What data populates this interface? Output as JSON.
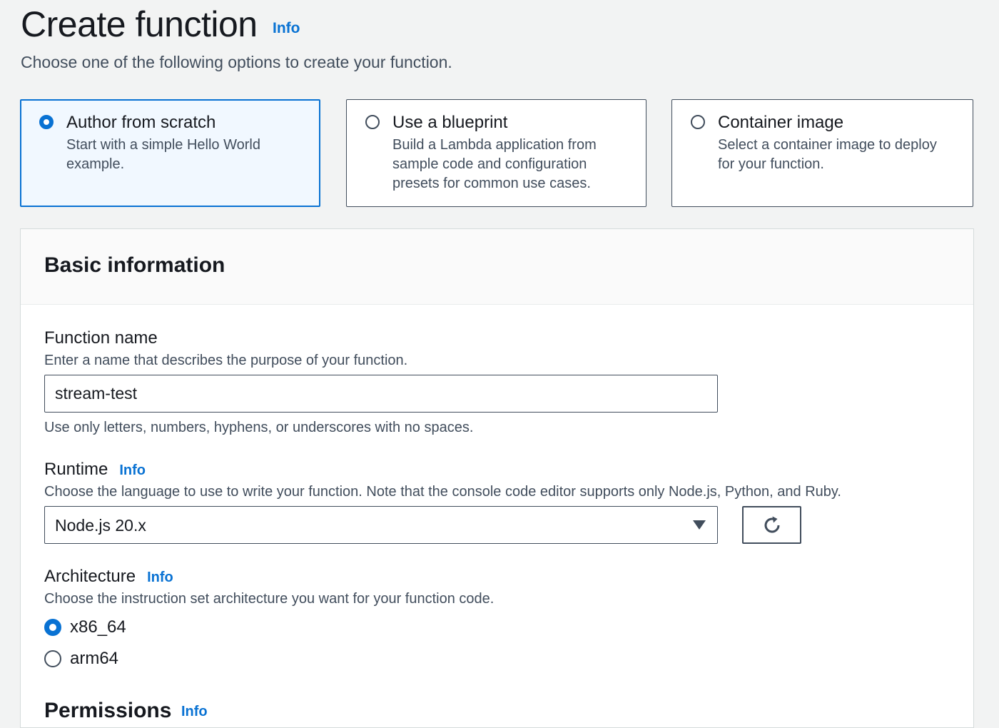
{
  "header": {
    "title": "Create function",
    "info_label": "Info",
    "description": "Choose one of the following options to create your function."
  },
  "creation_options": [
    {
      "title": "Author from scratch",
      "description": "Start with a simple Hello World example.",
      "selected": true
    },
    {
      "title": "Use a blueprint",
      "description": "Build a Lambda application from sample code and configuration presets for common use cases.",
      "selected": false
    },
    {
      "title": "Container image",
      "description": "Select a container image to deploy for your function.",
      "selected": false
    }
  ],
  "basic_information": {
    "title": "Basic information",
    "function_name": {
      "label": "Function name",
      "description": "Enter a name that describes the purpose of your function.",
      "value": "stream-test",
      "constraint": "Use only letters, numbers, hyphens, or underscores with no spaces."
    },
    "runtime": {
      "label": "Runtime",
      "info_label": "Info",
      "description": "Choose the language to use to write your function. Note that the console code editor supports only Node.js, Python, and Ruby.",
      "selected_value": "Node.js 20.x",
      "refresh_icon": "refresh-icon"
    },
    "architecture": {
      "label": "Architecture",
      "info_label": "Info",
      "description": "Choose the instruction set architecture you want for your function code.",
      "options": [
        {
          "label": "x86_64",
          "selected": true
        },
        {
          "label": "arm64",
          "selected": false
        }
      ]
    },
    "permissions": {
      "label": "Permissions",
      "info_label": "Info"
    }
  },
  "colors": {
    "accent": "#0972d3",
    "selected_tile_bg": "#f1f8ff",
    "text_primary": "#16191f",
    "text_secondary": "#414d5c",
    "page_bg": "#f2f3f3"
  }
}
